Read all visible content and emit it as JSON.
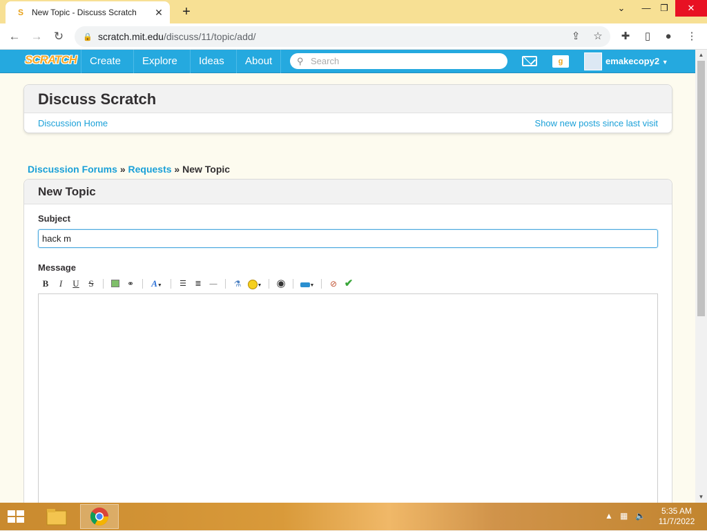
{
  "browser": {
    "tab_title": "New Topic - Discuss Scratch",
    "url_host": "scratch.mit.edu",
    "url_path": "/discuss/11/topic/add/"
  },
  "nav": {
    "logo": "SCRATCH",
    "links": [
      "Create",
      "Explore",
      "Ideas",
      "About"
    ],
    "search_placeholder": "Search",
    "mystuff_label": "g",
    "username": "emakecopy2"
  },
  "discuss": {
    "title": "Discuss Scratch",
    "home_link": "Discussion Home",
    "new_posts_link": "Show new posts since last visit"
  },
  "breadcrumb": {
    "forums": "Discussion Forums",
    "sep": "»",
    "category": "Requests",
    "current": "New Topic"
  },
  "form": {
    "heading": "New Topic",
    "subject_label": "Subject",
    "subject_value": "hack m",
    "message_label": "Message",
    "editor_buttons": {
      "bold": "B",
      "italic": "I",
      "underline": "U",
      "strike": "S",
      "font": "A"
    }
  },
  "taskbar": {
    "time": "5:35 AM",
    "date": "11/7/2022"
  },
  "colors": {
    "scratch_blue": "#25a9df",
    "link": "#1aa0d8",
    "tab_bar": "#f7e094"
  }
}
